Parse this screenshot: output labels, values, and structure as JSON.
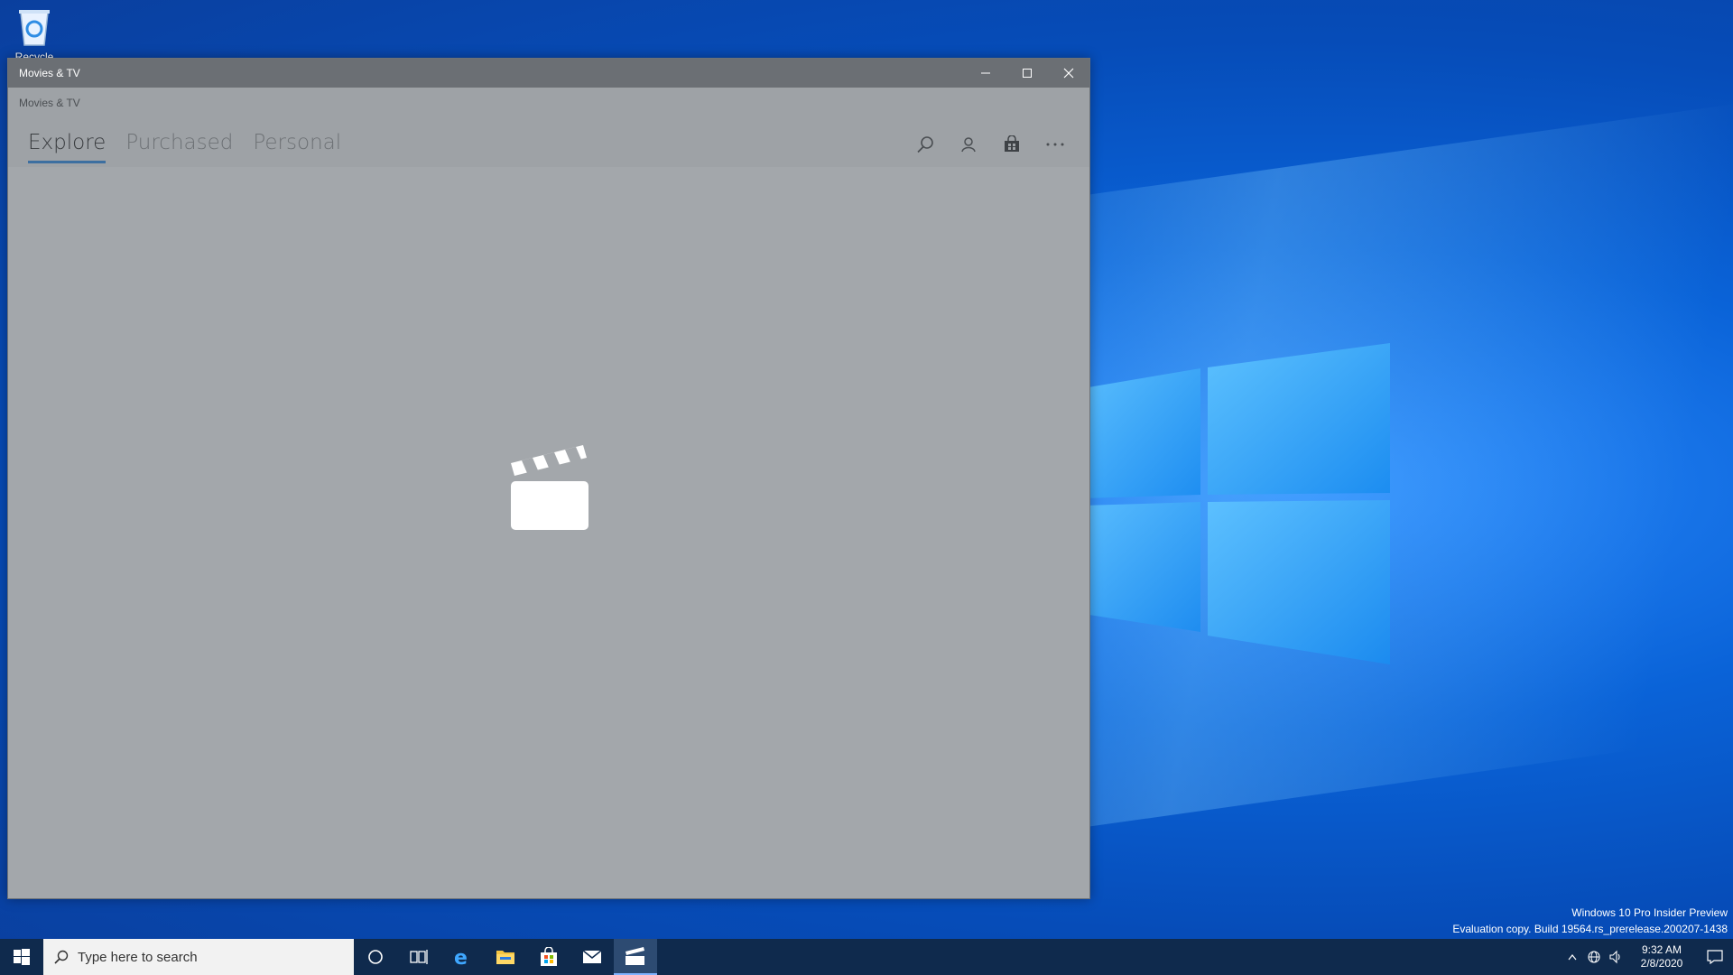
{
  "desktop": {
    "recycle_bin_label": "Recycle Bin",
    "watermark_line1": "Windows 10 Pro Insider Preview",
    "watermark_line2": "Evaluation copy. Build 19564.rs_prerelease.200207-1438"
  },
  "window": {
    "title": "Movies & TV",
    "app_name": "Movies & TV",
    "tabs": [
      {
        "label": "Explore",
        "active": true
      },
      {
        "label": "Purchased",
        "active": false
      },
      {
        "label": "Personal",
        "active": false
      }
    ],
    "actions": [
      "search-icon",
      "account-icon",
      "store-bag-icon",
      "more-icon"
    ],
    "splash_icon": "clapperboard-icon"
  },
  "taskbar": {
    "search_placeholder": "Type here to search",
    "pinned": [
      "start-icon",
      "cortana-icon",
      "task-view-icon",
      "edge-icon",
      "file-explorer-icon",
      "store-icon",
      "mail-icon",
      "movies-tv-icon"
    ],
    "active_app": "movies-tv-icon",
    "tray": {
      "time": "9:32 AM",
      "date": "2/8/2020",
      "icons": [
        "chevron-up-icon",
        "network-icon",
        "volume-icon",
        "notification-icon"
      ]
    }
  },
  "colors": {
    "desktop_blue": "#0a63d8",
    "window_gray": "#a3a7ab",
    "titlebar_gray": "#6b6f74",
    "accent": "#3d6fa0",
    "taskbar": "#0f2a4d"
  }
}
